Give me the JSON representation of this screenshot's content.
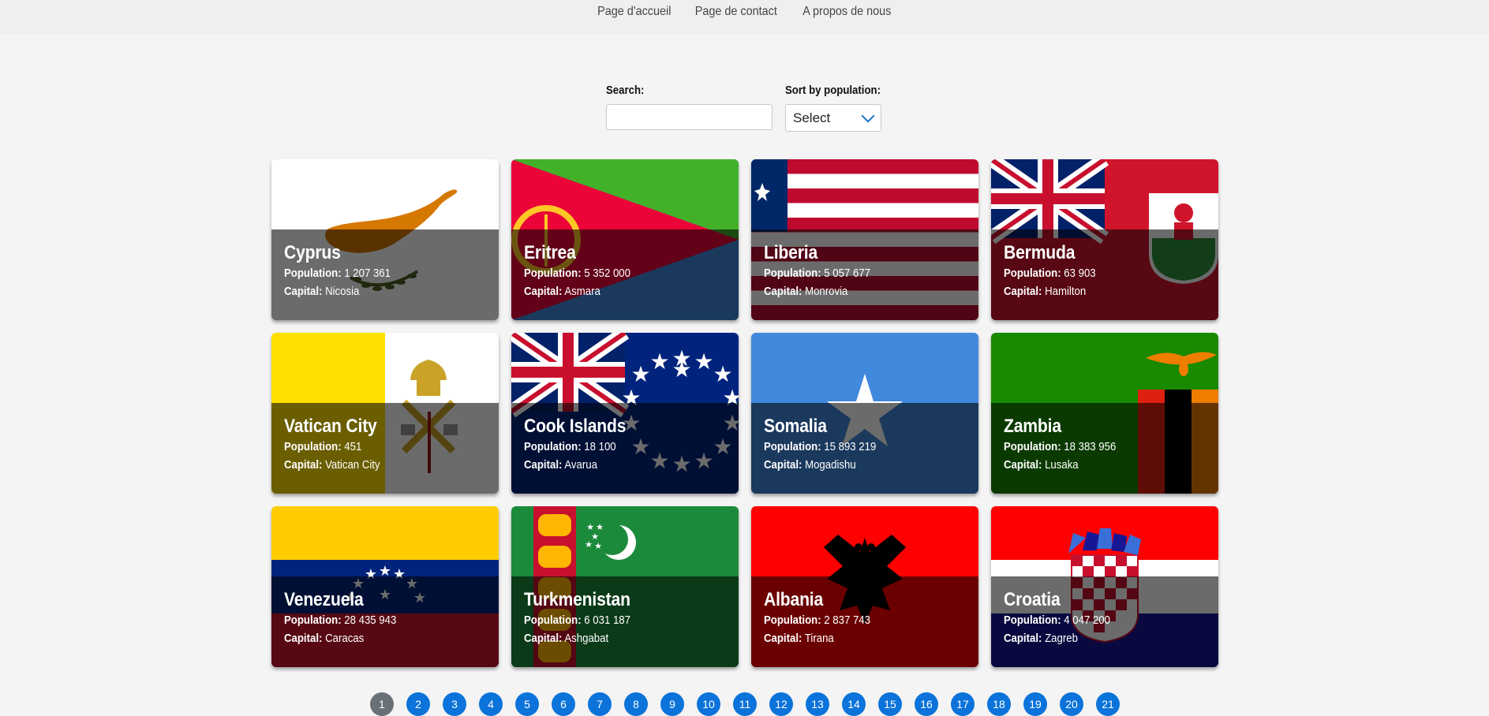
{
  "nav": {
    "links": [
      "Page d'accueil",
      "Page de contact",
      "A propos de nous"
    ]
  },
  "search": {
    "label": "Search:",
    "value": "",
    "placeholder": ""
  },
  "sort": {
    "label": "Sort by population:",
    "selected": "Select"
  },
  "cards": [
    {
      "name": "Cyprus",
      "population": "1 207 361",
      "capital": "Nicosia"
    },
    {
      "name": "Eritrea",
      "population": "5 352 000",
      "capital": "Asmara"
    },
    {
      "name": "Liberia",
      "population": "5 057 677",
      "capital": "Monrovia"
    },
    {
      "name": "Bermuda",
      "population": "63 903",
      "capital": "Hamilton"
    },
    {
      "name": "Vatican City",
      "population": "451",
      "capital": "Vatican City"
    },
    {
      "name": "Cook Islands",
      "population": "18 100",
      "capital": "Avarua"
    },
    {
      "name": "Somalia",
      "population": "15 893 219",
      "capital": "Mogadishu"
    },
    {
      "name": "Zambia",
      "population": "18 383 956",
      "capital": "Lusaka"
    },
    {
      "name": "Venezuela",
      "population": "28 435 943",
      "capital": "Caracas"
    },
    {
      "name": "Turkmenistan",
      "population": "6 031 187",
      "capital": "Ashgabat"
    },
    {
      "name": "Albania",
      "population": "2 837 743",
      "capital": "Tirana"
    },
    {
      "name": "Croatia",
      "population": "4 047 200",
      "capital": "Zagreb"
    }
  ],
  "labels": {
    "population": "Population:",
    "capital": "Capital:"
  },
  "pagination": {
    "pages": [
      "1",
      "2",
      "3",
      "4",
      "5",
      "6",
      "7",
      "8",
      "9",
      "10",
      "11",
      "12",
      "13",
      "14",
      "15",
      "16",
      "17",
      "18",
      "19",
      "20",
      "21"
    ],
    "current": "1"
  },
  "colors": {
    "accent": "#0b73d9",
    "page_active": "#6a7078",
    "background": "#f4f4f4"
  }
}
